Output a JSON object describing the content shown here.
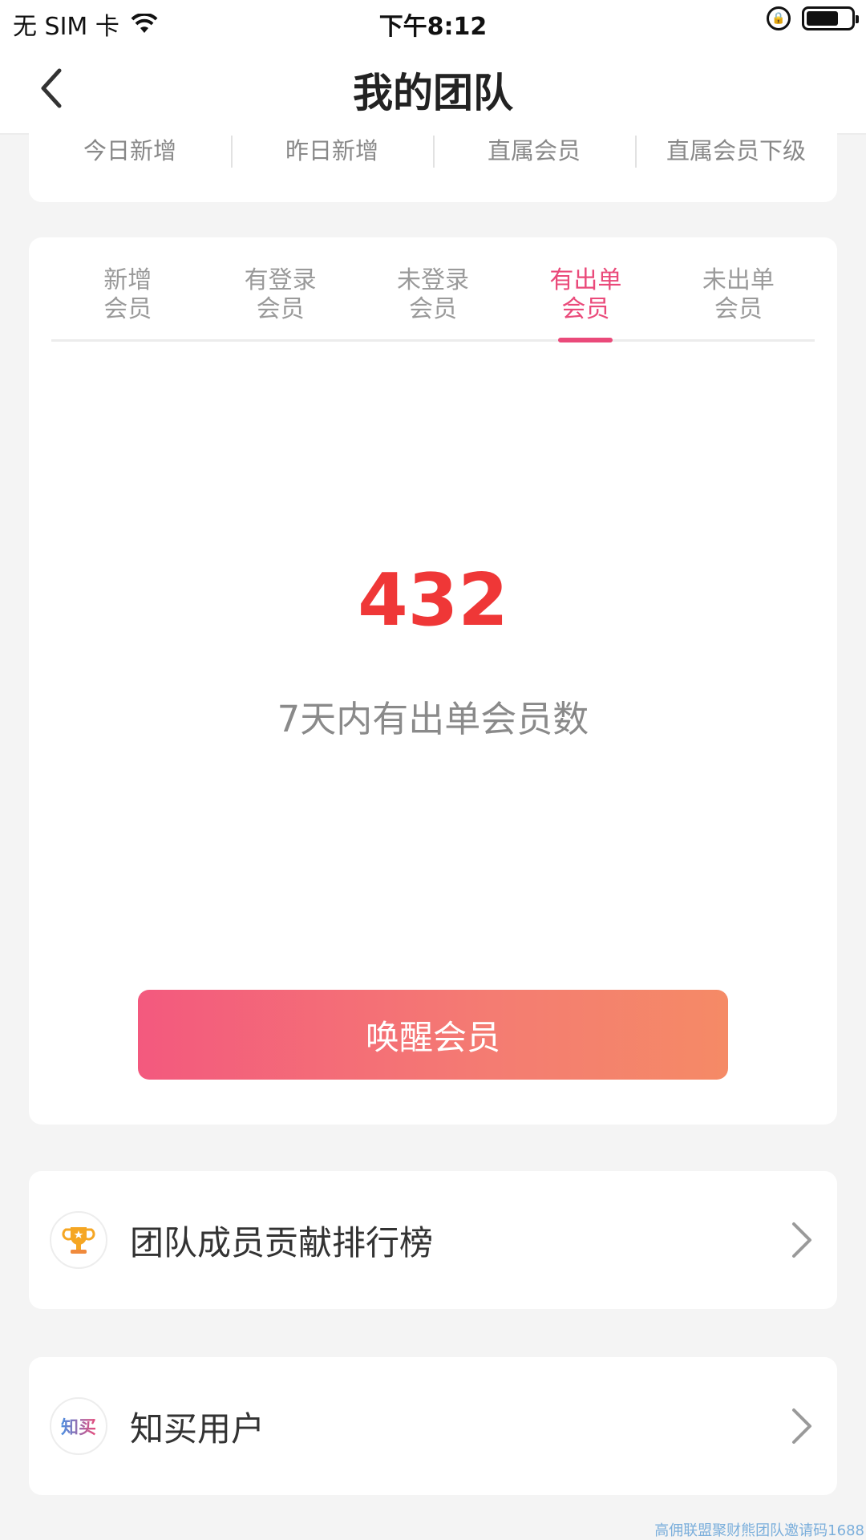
{
  "status_bar": {
    "carrier": "无 SIM 卡",
    "time": "下午8:12",
    "icons": [
      "wifi-icon",
      "rotation-lock-icon",
      "battery-icon"
    ]
  },
  "nav": {
    "title": "我的团队",
    "back_icon": "chevron-left-icon"
  },
  "stat_tabs": [
    "今日新增",
    "昨日新增",
    "直属会员",
    "直属会员下级"
  ],
  "filter_tabs": [
    {
      "line1": "新增",
      "line2": "会员",
      "active": false
    },
    {
      "line1": "有登录",
      "line2": "会员",
      "active": false
    },
    {
      "line1": "未登录",
      "line2": "会员",
      "active": false
    },
    {
      "line1": "有出单",
      "line2": "会员",
      "active": true
    },
    {
      "line1": "未出单",
      "line2": "会员",
      "active": false
    }
  ],
  "summary": {
    "value": "432",
    "caption": "7天内有出单会员数"
  },
  "wake_button": "唤醒会员",
  "list": [
    {
      "label": "团队成员贡献排行榜",
      "icon": "trophy-icon"
    },
    {
      "label": "知买用户",
      "icon": "zhimai-logo-icon",
      "logo_text": "知买"
    }
  ],
  "watermark": "高佣联盟聚财熊团队邀请码1688",
  "colors": {
    "accent": "#ea4a7a",
    "number": "#ef3737",
    "button_start": "#f3597e",
    "button_end": "#f58a66"
  }
}
